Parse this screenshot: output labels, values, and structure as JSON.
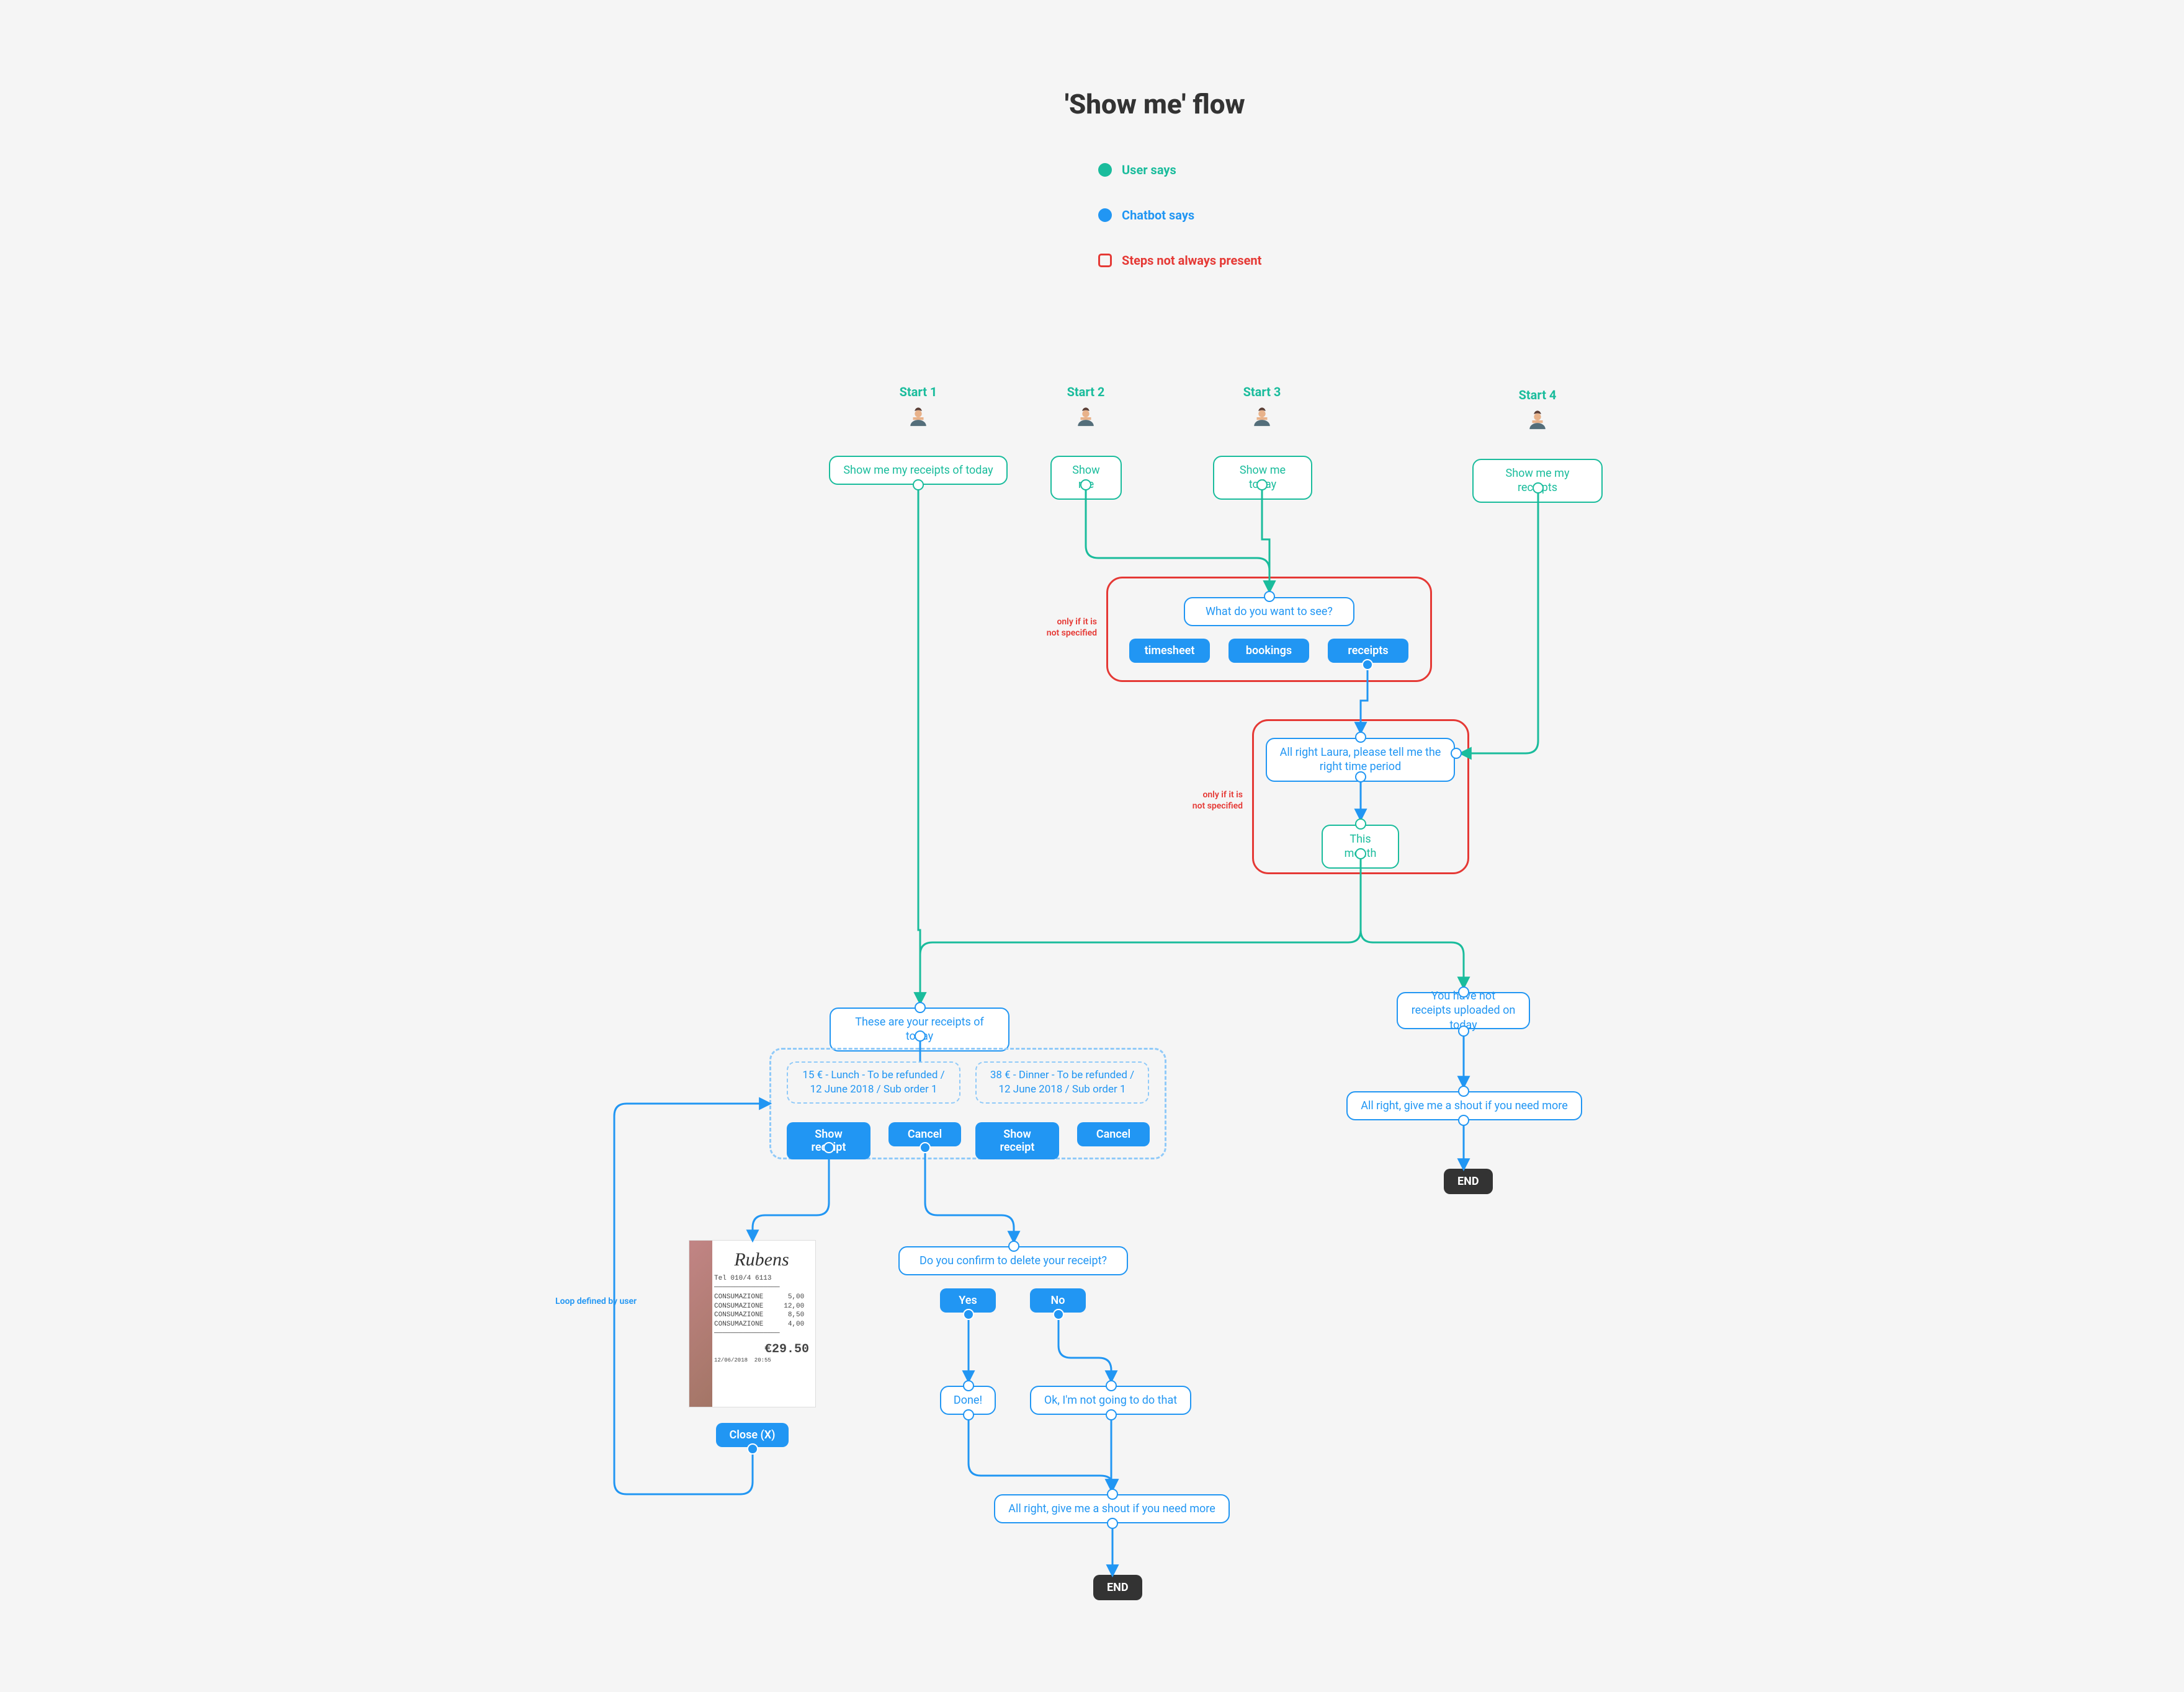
{
  "title": "'Show me' flow",
  "legend": {
    "user": {
      "label": "User says",
      "color": "#1abc9c"
    },
    "bot": {
      "label": "Chatbot says",
      "color": "#2196f3"
    },
    "opt": {
      "label": "Steps not always present",
      "color": "#e53935"
    }
  },
  "starts": {
    "s1": {
      "label": "Start 1",
      "bubble": "Show me my receipts of today"
    },
    "s2": {
      "label": "Start 2",
      "bubble": "Show me"
    },
    "s3": {
      "label": "Start 3",
      "bubble": "Show me today"
    },
    "s4": {
      "label": "Start 4",
      "bubble": "Show me my receipts"
    }
  },
  "conditional1": {
    "note": "only if it is\nnot specified",
    "question": "What do you want to see?",
    "options": {
      "a": "timesheet",
      "b": "bookings",
      "c": "receipts"
    }
  },
  "conditional2": {
    "note": "only if it is\nnot specified",
    "prompt": "All right Laura, please tell me the right time period",
    "answer": "This month"
  },
  "results": {
    "have": "These are your receipts of today",
    "havenot": "You have not receipts uploaded on today",
    "shout": "All right, give me a shout if you need more",
    "end": "END"
  },
  "carousel": {
    "card1": "15 € - Lunch - To be refunded / 12 June 2018 / Sub order 1",
    "card2": "38 € - Dinner - To be refunded / 12 June 2018 / Sub order 1",
    "show": "Show receipt",
    "cancel": "Cancel"
  },
  "loop_label": "Loop defined by user",
  "confirm": {
    "q": "Do you confirm to delete your receipt?",
    "yes": "Yes",
    "no": "No",
    "done": "Done!",
    "nope": "Ok, I'm not going to do that"
  },
  "receipt_img": {
    "brand": "Rubens",
    "total": "€29.50",
    "close": "Close (X)"
  }
}
